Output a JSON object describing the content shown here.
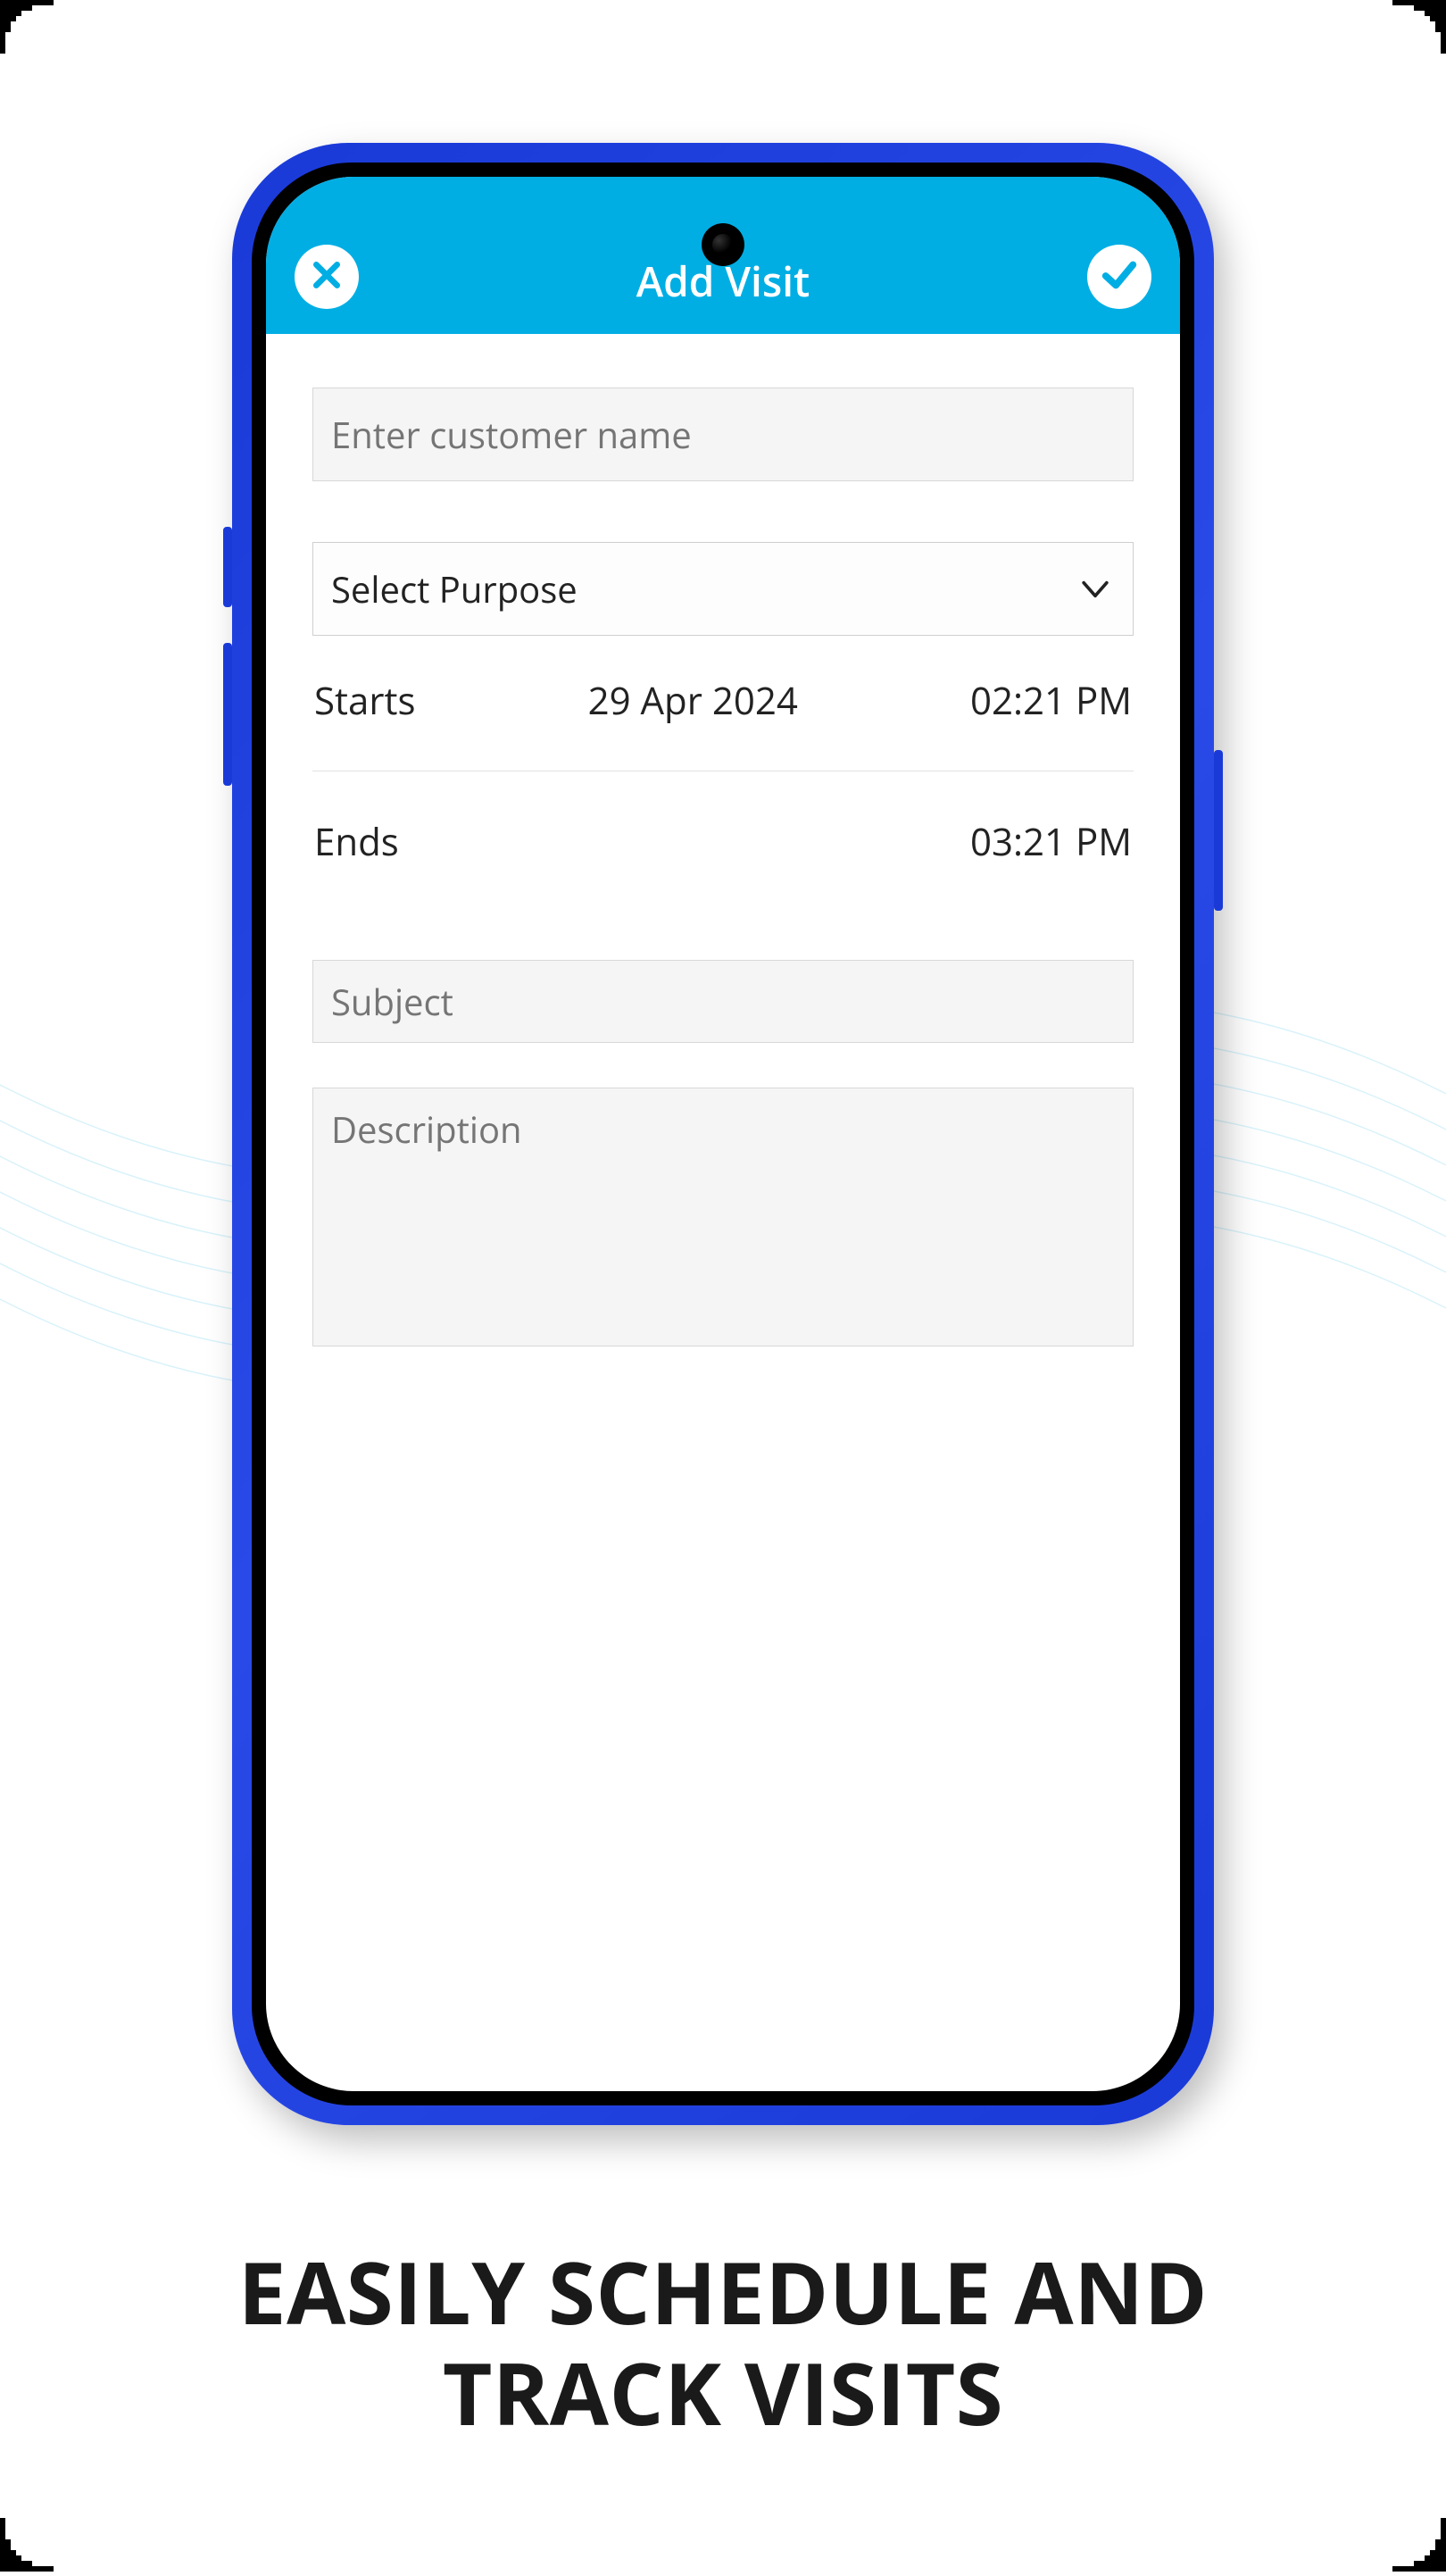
{
  "header": {
    "title": "Add Visit"
  },
  "form": {
    "customer_placeholder": "Enter customer name",
    "purpose_label": "Select Purpose",
    "starts_label": "Starts",
    "starts_date": "29 Apr 2024",
    "starts_time": "02:21 PM",
    "ends_label": "Ends",
    "ends_time": "03:21 PM",
    "subject_placeholder": "Subject",
    "description_placeholder": "Description"
  },
  "promo": {
    "line1": "EASILY SCHEDULE AND",
    "line2": "TRACK VISITS"
  },
  "colors": {
    "accent": "#00aee4",
    "frame": "#1a3ad8"
  }
}
